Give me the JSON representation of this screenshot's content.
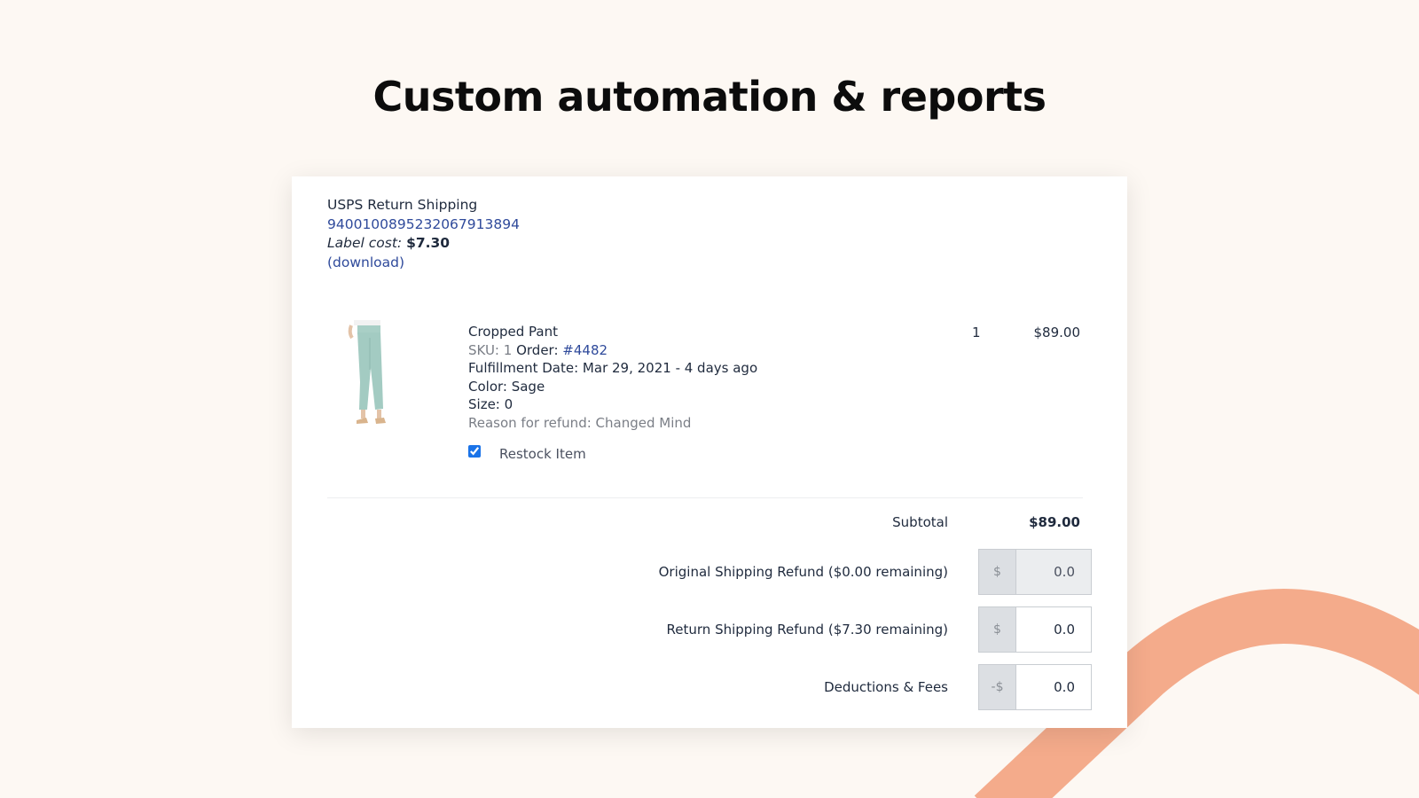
{
  "headline": "Custom automation & reports",
  "shipping": {
    "title": "USPS Return Shipping",
    "tracking_number": "9400100895232067913894",
    "label_cost_label": "Label cost:",
    "label_cost_value": "$7.30",
    "download_link": "(download)"
  },
  "item": {
    "image_icon": "cropped-pant-product-photo",
    "name": "Cropped Pant",
    "sku_label": "SKU: 1",
    "order_label": "Order:",
    "order_number": "#4482",
    "fulfillment": "Fulfillment Date: Mar 29, 2021 - 4 days ago",
    "color": "Color: Sage",
    "size": "Size: 0",
    "reason": "Reason for refund: Changed Mind",
    "quantity": "1",
    "price": "$89.00",
    "restock_label": "Restock Item",
    "restock_checked": true
  },
  "summary": {
    "subtotal_label": "Subtotal",
    "subtotal_value": "$89.00",
    "original_shipping_label": "Original Shipping Refund ($0.00 remaining)",
    "original_shipping_prefix": "$",
    "original_shipping_value": "0.0",
    "return_shipping_label": "Return Shipping Refund ($7.30 remaining)",
    "return_shipping_prefix": "$",
    "return_shipping_value": "0.0",
    "deductions_label": "Deductions & Fees",
    "deductions_prefix": "-$",
    "deductions_value": "0.0"
  },
  "colors": {
    "background": "#fdf8f3",
    "accent_arc": "#f4ab8b",
    "link": "#2f4a9b",
    "checkbox": "#1a73e8"
  }
}
